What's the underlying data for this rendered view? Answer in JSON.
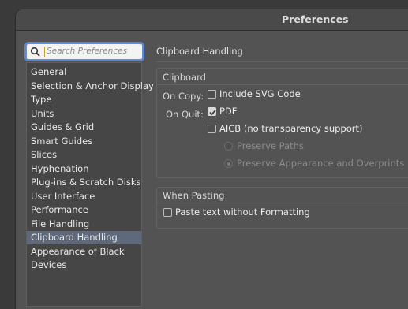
{
  "window": {
    "title": "Preferences"
  },
  "search": {
    "placeholder": "Search Preferences"
  },
  "sidebar": {
    "items": [
      {
        "label": "General"
      },
      {
        "label": "Selection & Anchor Display"
      },
      {
        "label": "Type"
      },
      {
        "label": "Units"
      },
      {
        "label": "Guides & Grid"
      },
      {
        "label": "Smart Guides"
      },
      {
        "label": "Slices"
      },
      {
        "label": "Hyphenation"
      },
      {
        "label": "Plug-ins & Scratch Disks"
      },
      {
        "label": "User Interface"
      },
      {
        "label": "Performance"
      },
      {
        "label": "File Handling"
      },
      {
        "label": "Clipboard Handling",
        "selected": true
      },
      {
        "label": "Appearance of Black"
      },
      {
        "label": "Devices"
      }
    ]
  },
  "content": {
    "heading": "Clipboard Handling",
    "clipboard": {
      "group_title": "Clipboard",
      "on_copy_label": "On Copy:",
      "on_quit_label": "On Quit:",
      "include_svg": {
        "label": "Include SVG Code",
        "checked": false
      },
      "pdf": {
        "label": "PDF",
        "checked": true
      },
      "aicb": {
        "label": "AICB (no transparency support)",
        "checked": false
      },
      "preserve_paths": {
        "label": "Preserve Paths",
        "selected": false,
        "enabled": false
      },
      "preserve_appearance": {
        "label": "Preserve Appearance and Overprints",
        "selected": true,
        "enabled": false
      }
    },
    "pasting": {
      "group_title": "When Pasting",
      "paste_without_formatting": {
        "label": "Paste text without Formatting",
        "checked": false
      }
    }
  }
}
